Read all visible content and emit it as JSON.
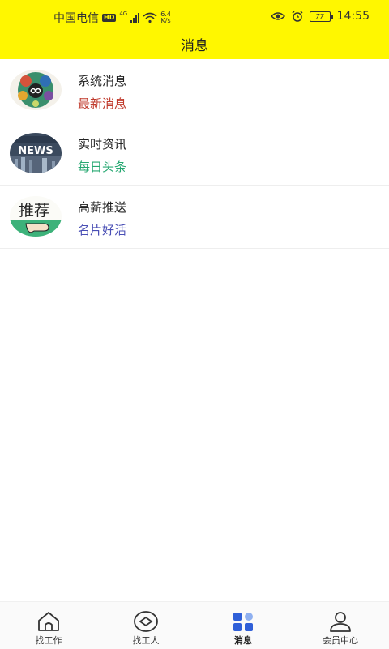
{
  "status_bar": {
    "carrier": "中国电信",
    "hd_badge": "HD",
    "network": "4G",
    "speed_value": "6.4",
    "speed_unit": "K/s",
    "battery": "77",
    "time": "14:55",
    "icons": [
      "eye-icon",
      "alarm-icon"
    ]
  },
  "header": {
    "title": "消息"
  },
  "messages": [
    {
      "title": "系统消息",
      "subtitle": "最新消息",
      "subtitle_color": "#c0392b"
    },
    {
      "title": "实时资讯",
      "subtitle": "每日头条",
      "subtitle_color": "#27a872"
    },
    {
      "title": "高薪推送",
      "subtitle": "名片好活",
      "subtitle_color": "#4a4fb5"
    }
  ],
  "avatar_text": {
    "news": "NEWS",
    "recommend": "推荐"
  },
  "bottom_nav": [
    {
      "label": "找工作",
      "icon": "home-icon"
    },
    {
      "label": "找工人",
      "icon": "eye-circle-icon"
    },
    {
      "label": "消息",
      "icon": "grid-icon",
      "active": true
    },
    {
      "label": "会员中心",
      "icon": "user-icon"
    }
  ],
  "colors": {
    "header_bg": "#fff700",
    "active_icon": "#2f5fd8"
  }
}
